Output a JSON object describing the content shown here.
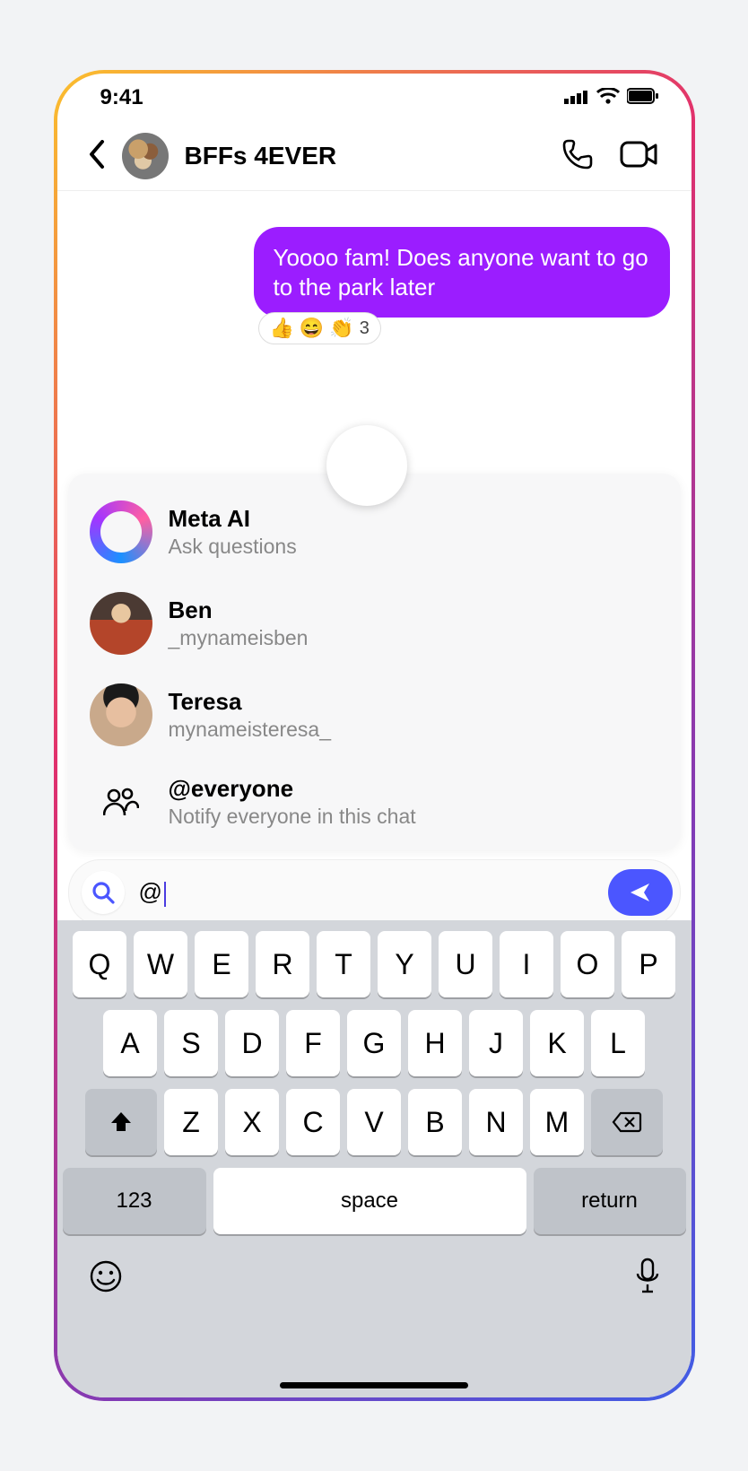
{
  "statusbar": {
    "time": "9:41"
  },
  "header": {
    "title": "BFFs 4EVER"
  },
  "messages": {
    "outgoing_text": "Yoooo fam! Does anyone want to go to the park later",
    "reactions": {
      "e1": "👍",
      "e2": "😄",
      "e3": "👏",
      "count": "3"
    }
  },
  "mentions": {
    "items": [
      {
        "name": "Meta AI",
        "sub": "Ask questions"
      },
      {
        "name": "Ben",
        "sub": "_mynameisben"
      },
      {
        "name": "Teresa",
        "sub": "mynameisteresa_"
      },
      {
        "name": "@everyone",
        "sub": "Notify everyone in this chat"
      }
    ]
  },
  "input": {
    "value": "@"
  },
  "keyboard": {
    "row1": [
      "Q",
      "W",
      "E",
      "R",
      "T",
      "Y",
      "U",
      "I",
      "O",
      "P"
    ],
    "row2": [
      "A",
      "S",
      "D",
      "F",
      "G",
      "H",
      "J",
      "K",
      "L"
    ],
    "row3": [
      "Z",
      "X",
      "C",
      "V",
      "B",
      "N",
      "M"
    ],
    "numkey": "123",
    "space": "space",
    "return": "return"
  }
}
